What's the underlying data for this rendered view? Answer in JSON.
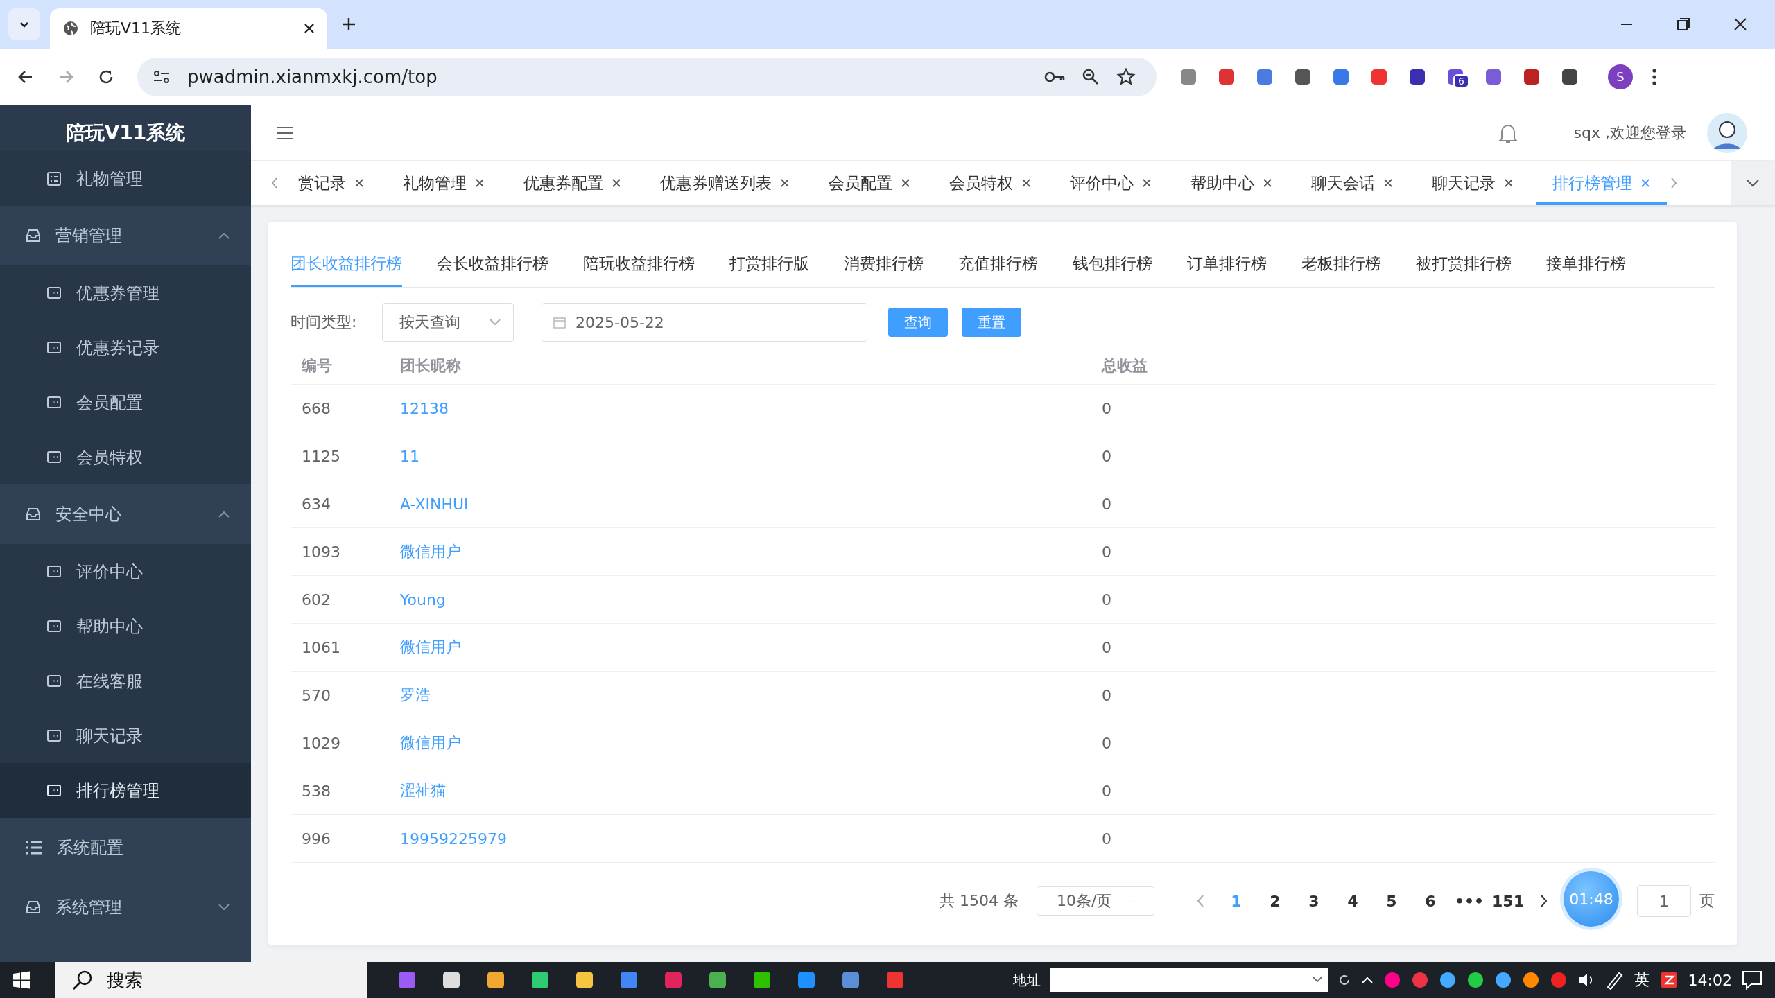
{
  "browser": {
    "tab_title": "陪玩V11系统",
    "url": "pwadmin.xianmxkj.com/top",
    "extension_badge": "6",
    "profile": "S"
  },
  "sidebar": {
    "title": "陪玩V11系统",
    "items": [
      {
        "label": "礼物管理",
        "kind": "sub",
        "selected": false
      },
      {
        "label": "营销管理",
        "kind": "group",
        "expanded": true,
        "children": [
          {
            "label": "优惠券管理",
            "selected": false
          },
          {
            "label": "优惠券记录",
            "selected": false
          },
          {
            "label": "会员配置",
            "selected": false
          },
          {
            "label": "会员特权",
            "selected": false
          }
        ]
      },
      {
        "label": "安全中心",
        "kind": "group",
        "expanded": true,
        "children": [
          {
            "label": "评价中心",
            "selected": false
          },
          {
            "label": "帮助中心",
            "selected": false
          },
          {
            "label": "在线客服",
            "selected": false
          },
          {
            "label": "聊天记录",
            "selected": false
          },
          {
            "label": "排行榜管理",
            "selected": true
          }
        ]
      },
      {
        "label": "系统配置",
        "kind": "link",
        "selected": false
      },
      {
        "label": "系统管理",
        "kind": "group",
        "expanded": false
      }
    ]
  },
  "header": {
    "user_greeting": "sqx ,欢迎您登录"
  },
  "page_tabs": [
    {
      "label": "赏记录",
      "selected": false
    },
    {
      "label": "礼物管理",
      "selected": false
    },
    {
      "label": "优惠券配置",
      "selected": false
    },
    {
      "label": "优惠券赠送列表",
      "selected": false
    },
    {
      "label": "会员配置",
      "selected": false
    },
    {
      "label": "会员特权",
      "selected": false
    },
    {
      "label": "评价中心",
      "selected": false
    },
    {
      "label": "帮助中心",
      "selected": false
    },
    {
      "label": "聊天会话",
      "selected": false
    },
    {
      "label": "聊天记录",
      "selected": false
    },
    {
      "label": "排行榜管理",
      "selected": true
    }
  ],
  "rank_tabs": [
    {
      "label": "团长收益排行榜",
      "selected": true
    },
    {
      "label": "会长收益排行榜",
      "selected": false
    },
    {
      "label": "陪玩收益排行榜",
      "selected": false
    },
    {
      "label": "打赏排行版",
      "selected": false
    },
    {
      "label": "消费排行榜",
      "selected": false
    },
    {
      "label": "充值排行榜",
      "selected": false
    },
    {
      "label": "钱包排行榜",
      "selected": false
    },
    {
      "label": "订单排行榜",
      "selected": false
    },
    {
      "label": "老板排行榜",
      "selected": false
    },
    {
      "label": "被打赏排行榜",
      "selected": false
    },
    {
      "label": "接单排行榜",
      "selected": false
    }
  ],
  "filter": {
    "label": "时间类型:",
    "time_type": "按天查询",
    "date": "2025-05-22",
    "buttons": [
      "查询",
      "重置"
    ]
  },
  "table": {
    "columns": [
      "编号",
      "团长昵称",
      "总收益"
    ],
    "rows": [
      [
        "668",
        "12138",
        "0"
      ],
      [
        "1125",
        "11",
        "0"
      ],
      [
        "634",
        "A-XINHUI",
        "0"
      ],
      [
        "1093",
        "微信用户",
        "0"
      ],
      [
        "602",
        "Young",
        "0"
      ],
      [
        "1061",
        "微信用户",
        "0"
      ],
      [
        "570",
        "罗浩",
        "0"
      ],
      [
        "1029",
        "微信用户",
        "0"
      ],
      [
        "538",
        "涩祉猫",
        "0"
      ],
      [
        "996",
        "19959225979",
        "0"
      ]
    ]
  },
  "pagination": {
    "total": "共 1504 条",
    "page_size": "10条/页",
    "pages": [
      {
        "label": "1",
        "selected": true
      },
      {
        "label": "2",
        "selected": false
      },
      {
        "label": "3",
        "selected": false
      },
      {
        "label": "4",
        "selected": false
      },
      {
        "label": "5",
        "selected": false
      },
      {
        "label": "6",
        "selected": false
      },
      {
        "label": "•••",
        "selected": false
      },
      {
        "label": "151",
        "selected": false
      }
    ],
    "jump_value": "1",
    "jump_suffix": "页"
  },
  "timer": "01:48",
  "taskbar": {
    "search": "搜索",
    "address_label": "地址",
    "ime": "英",
    "clock": "14:02"
  }
}
